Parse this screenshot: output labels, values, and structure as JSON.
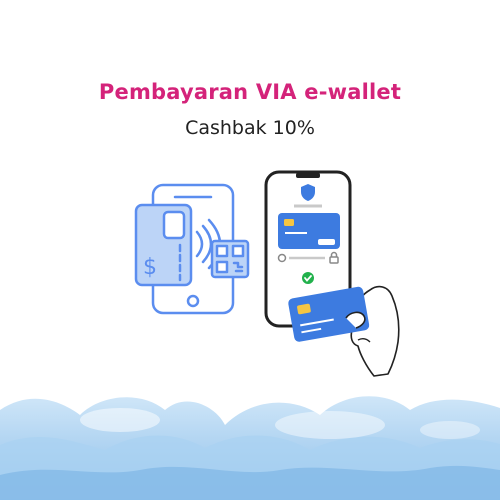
{
  "promo": {
    "title": "Pembayaran VIA e-wallet",
    "subtitle": "Cashbak 10%"
  },
  "colors": {
    "title": "#d4237a",
    "icon_outline": "#5b8def",
    "icon_fill": "#bcd4f7",
    "card_blue": "#3d7be0",
    "success_green": "#22b14c",
    "cloud": "#9ec9ee"
  },
  "icons": [
    "payment-phone-icon",
    "qr-code-icon",
    "nfc-signal-icon",
    "credit-card-icon",
    "smartphone-icon",
    "shield-check-icon",
    "checkmark-icon",
    "lock-icon",
    "hand-holding-card-icon",
    "cloud-decoration"
  ]
}
